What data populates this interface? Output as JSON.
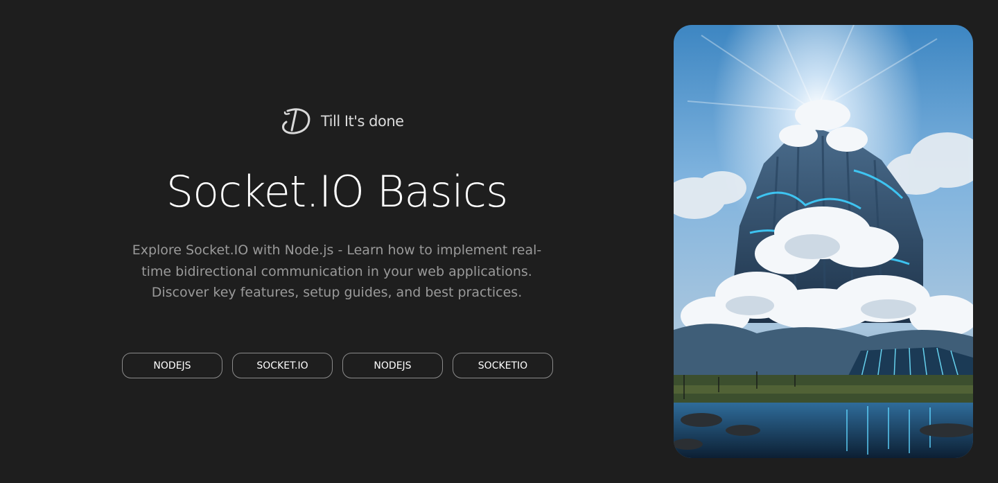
{
  "brand": {
    "name": "Till It's done",
    "logo_icon": "td-monogram-icon"
  },
  "hero": {
    "title": "Socket.IO Basics",
    "description": "Explore Socket.IO with Node.js - Learn how to implement real-time bidirectional communication in your web applications. Discover key features, setup guides, and best practices."
  },
  "tags": [
    {
      "label": "NODEJS"
    },
    {
      "label": "SOCKET.IO"
    },
    {
      "label": "NODEJS"
    },
    {
      "label": "SOCKETIO"
    }
  ],
  "colors": {
    "background": "#1e1e1e",
    "title": "#ffffff",
    "description": "#9a9a9a",
    "tag_border": "#8c8c8c",
    "accent_glow": "#3fd0ff"
  }
}
